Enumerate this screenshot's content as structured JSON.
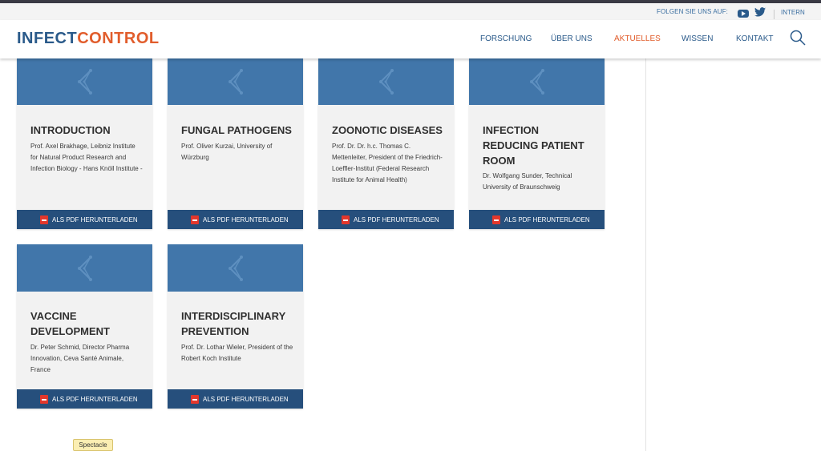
{
  "utility": {
    "follow_label": "FOLGEN SIE UNS AUF:",
    "icons": [
      "youtube-icon",
      "twitter-icon"
    ],
    "intern_label": "INTERN"
  },
  "brand": {
    "part1": "INFECT",
    "part2": "CONTROL",
    "color_primary": "#2a5a8a",
    "color_accent": "#e15d2c"
  },
  "nav": {
    "items": [
      {
        "label": "FORSCHUNG",
        "active": false
      },
      {
        "label": "ÜBER UNS",
        "active": false
      },
      {
        "label": "AKTUELLES",
        "active": true
      },
      {
        "label": "WISSEN",
        "active": false
      },
      {
        "label": "KONTAKT",
        "active": false
      }
    ],
    "search_icon": "search-icon"
  },
  "cards": [
    {
      "title": "INTRODUCTION",
      "description": "Prof. Axel Brakhage, Leibniz Institute for Natural Product Research and Infection Biology - Hans Knöll Institute -",
      "download_label": "ALS PDF HERUNTERLADEN"
    },
    {
      "title": "FUNGAL PATHOGENS",
      "description": "Prof. Oliver Kurzai, University of Würzburg",
      "download_label": "ALS PDF HERUNTERLADEN"
    },
    {
      "title": "ZOONOTIC DISEASES",
      "description": "Prof. Dr. Dr. h.c. Thomas C. Mettenleiter, President of the Friedrich-Loeffler-Institut (Federal Research Institute for Animal Health)",
      "download_label": "ALS PDF HERUNTERLADEN"
    },
    {
      "title": "INFECTION REDUCING PATIENT ROOM",
      "description": "Dr. Wolfgang Sunder, Technical University of Braunschweig",
      "download_label": "ALS PDF HERUNTERLADEN"
    },
    {
      "title": "VACCINE DEVELOPMENT",
      "description": "Dr. Peter Schmid, Director Pharma Innovation, Ceva Santé Animale, France",
      "download_label": "ALS PDF HERUNTERLADEN"
    },
    {
      "title": "INTERDISCIPLINARY PREVENTION",
      "description": "Prof. Dr. Lothar Wieler, President of the Robert Koch Institute",
      "download_label": "ALS PDF HERUNTERLADEN"
    }
  ],
  "badge": {
    "label": "Spectacle"
  }
}
